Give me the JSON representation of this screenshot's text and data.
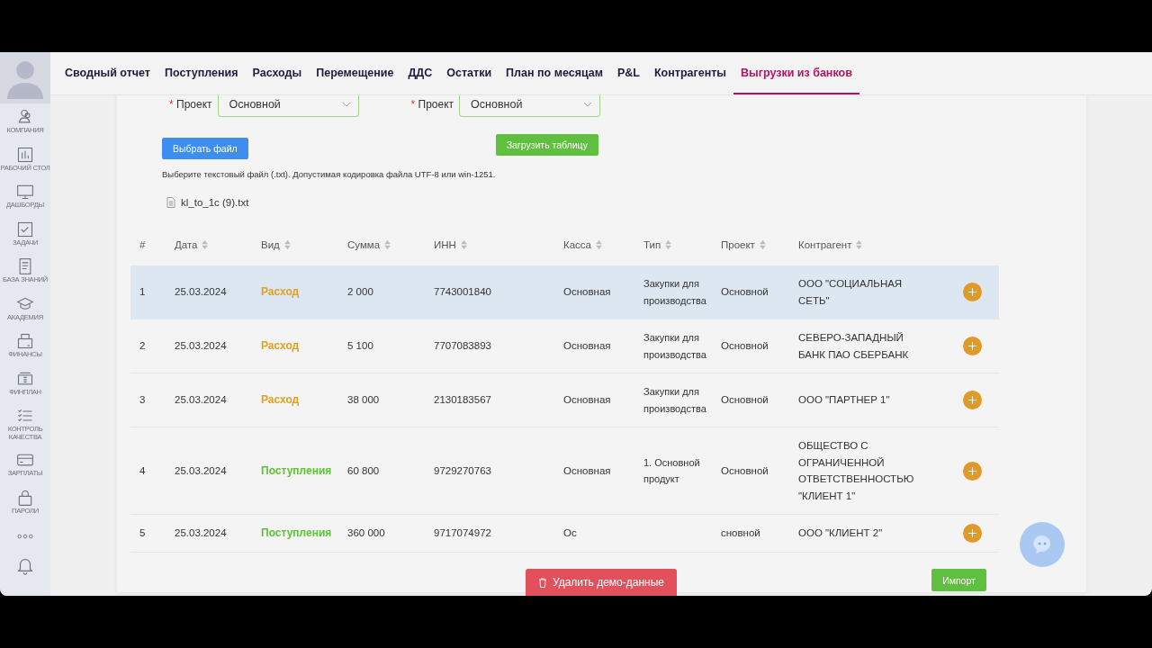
{
  "sidebar": {
    "items": [
      {
        "label": "КОМПАНИЯ"
      },
      {
        "label": "РАБОЧИЙ СТОЛ"
      },
      {
        "label": "ДАШБОРДЫ"
      },
      {
        "label": "ЗАДАЧИ"
      },
      {
        "label": "БАЗА ЗНАНИЙ"
      },
      {
        "label": "АКАДЕМИЯ"
      },
      {
        "label": "ФИНАНСЫ"
      },
      {
        "label": "ФИНПЛАН"
      },
      {
        "label": "КОНТРОЛЬ КАЧЕСТВА"
      },
      {
        "label": "ЗАРПЛАТЫ"
      },
      {
        "label": "ПАРОЛИ"
      }
    ]
  },
  "tabs": [
    {
      "label": "Сводный отчет",
      "selected": false
    },
    {
      "label": "Поступления",
      "selected": false
    },
    {
      "label": "Расходы",
      "selected": false
    },
    {
      "label": "Перемещение",
      "selected": false
    },
    {
      "label": "ДДС",
      "selected": false
    },
    {
      "label": "Остатки",
      "selected": false
    },
    {
      "label": "План по месяцам",
      "selected": false
    },
    {
      "label": "P&L",
      "selected": false
    },
    {
      "label": "Контрагенты",
      "selected": false
    },
    {
      "label": "Выгрузки из банков",
      "selected": true
    }
  ],
  "project_fields": [
    {
      "required_mark": "*",
      "label": "Проект",
      "value": "Основной"
    },
    {
      "required_mark": "*",
      "label": "Проект",
      "value": "Основной"
    }
  ],
  "choose_file_button": "Выбрать файл",
  "load_table_button": "Загрузить таблицу",
  "hint": "Выберите текстовый файл (.txt). Допустимая кодировка файла UTF-8 или win-1251.",
  "file_name": "kl_to_1c (9).txt",
  "table": {
    "columns": [
      "#",
      "Дата",
      "Вид",
      "Сумма",
      "ИНН",
      "Касса",
      "Тип",
      "Проект",
      "Контрагент"
    ],
    "rows": [
      {
        "number": "1",
        "date": "25.03.2024",
        "kind": "expense",
        "type_label": "Расход",
        "amount": "2 000",
        "inn": "7743001840",
        "cash": "Основная",
        "category": "Закупки для производства",
        "project": "Основной",
        "counterparty": "ООО \"СОЦИАЛЬНАЯ СЕТЬ\"",
        "selected": true
      },
      {
        "number": "2",
        "date": "25.03.2024",
        "kind": "expense",
        "type_label": "Расход",
        "amount": "5 100",
        "inn": "7707083893",
        "cash": "Основная",
        "category": "Закупки для производства",
        "project": "Основной",
        "counterparty": "СЕВЕРО-ЗАПАДНЫЙ БАНК ПАО СБЕРБАНК",
        "selected": false
      },
      {
        "number": "3",
        "date": "25.03.2024",
        "kind": "expense",
        "type_label": "Расход",
        "amount": "38 000",
        "inn": "2130183567",
        "cash": "Основная",
        "category": "Закупки для производства",
        "project": "Основной",
        "counterparty": "ООО \"ПАРТНЕР 1\"",
        "selected": false
      },
      {
        "number": "4",
        "date": "25.03.2024",
        "kind": "income",
        "type_label": "Поступления",
        "amount": "60 800",
        "inn": "9729270763",
        "cash": "Основная",
        "category": "1. Основной продукт",
        "project": "Основной",
        "counterparty": "ОБЩЕСТВО С ОГРАНИЧЕННОЙ ОТВЕТСТВЕННОСТЬЮ \"КЛИЕНТ 1\"",
        "selected": false
      },
      {
        "number": "5",
        "date": "25.03.2024",
        "kind": "income",
        "type_label": "Поступления",
        "amount": "360 000",
        "inn": "9717074972",
        "cash": "Ос",
        "project": "сновной",
        "counterparty": "ООО \"КЛИЕНТ 2\"",
        "selected": false
      }
    ]
  },
  "delete_demo_button": "Удалить демо-данные",
  "import_button": "Импорт"
}
